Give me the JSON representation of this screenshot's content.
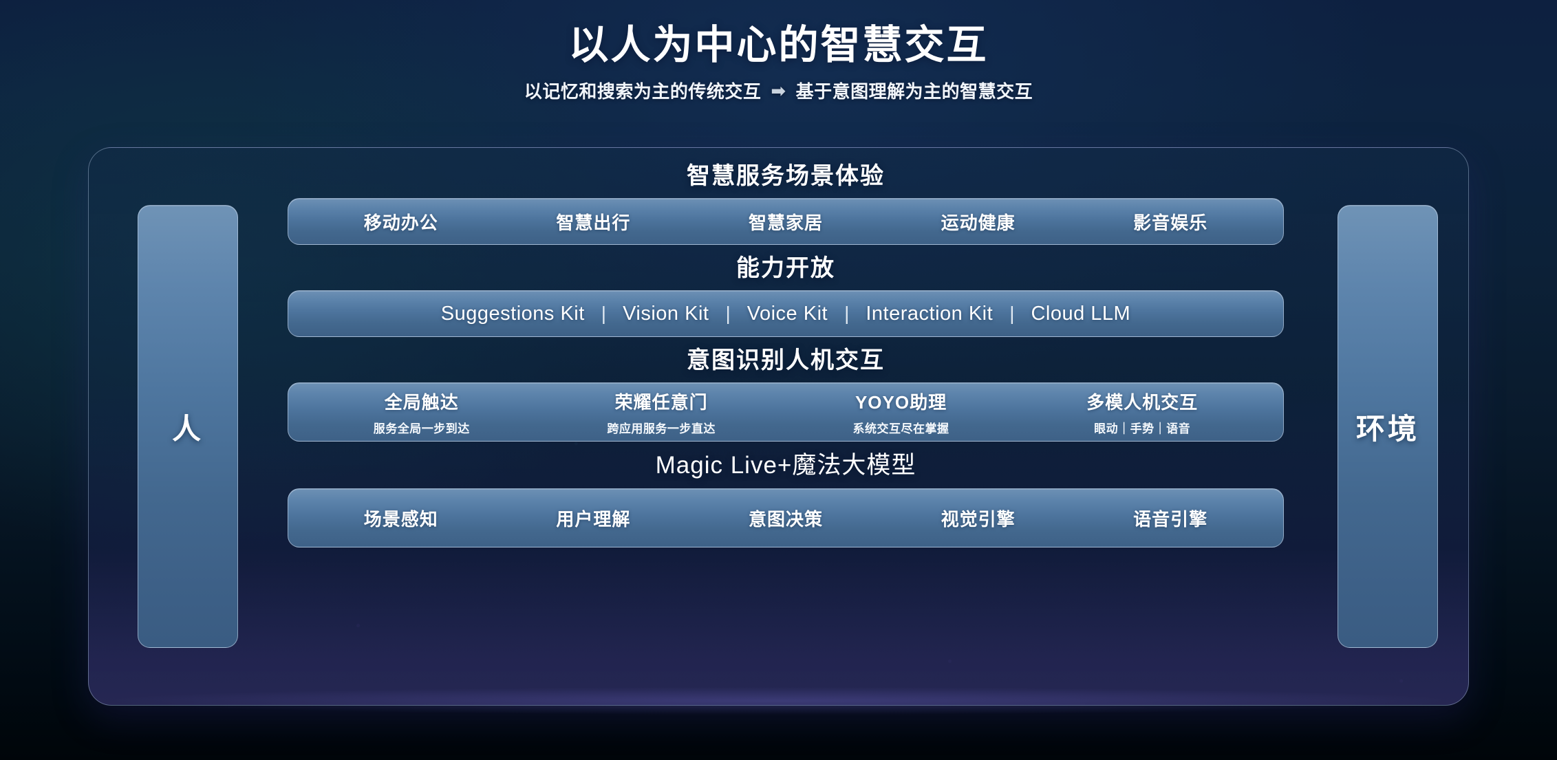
{
  "header": {
    "title": "以人为中心的智慧交互",
    "subtitle_before": "以记忆和搜索为主的传统交互",
    "subtitle_arrow": "➡",
    "subtitle_after": "基于意图理解为主的智慧交互"
  },
  "pillars": {
    "left": "人",
    "right": "环境"
  },
  "sections": [
    {
      "title": "智慧服务场景体验",
      "items": [
        "移动办公",
        "智慧出行",
        "智慧家居",
        "运动健康",
        "影音娱乐"
      ]
    },
    {
      "title": "能力开放",
      "items": [
        "Suggestions Kit",
        "Vision Kit",
        "Voice Kit",
        "Interaction Kit",
        "Cloud LLM"
      ],
      "separator": "|"
    },
    {
      "title": "意图识别人机交互",
      "items": [
        {
          "title": "全局触达",
          "sub": "服务全局一步到达"
        },
        {
          "title": "荣耀任意门",
          "sub": "跨应用服务一步直达"
        },
        {
          "title": "YOYO助理",
          "sub": "系统交互尽在掌握"
        },
        {
          "title": "多模人机交互",
          "sub": "眼动｜手势｜语音"
        }
      ]
    },
    {
      "title": "Magic Live+魔法大模型",
      "items": [
        "场景感知",
        "用户理解",
        "意图决策",
        "视觉引擎",
        "语音引擎"
      ]
    }
  ],
  "colors": {
    "bar_top": "#6d90b4",
    "bar_bottom": "#3e6187",
    "frame_border": "#b0c4de",
    "background_deep": "#04111d",
    "glow_purple": "#6e68c8",
    "text": "#ffffff"
  }
}
